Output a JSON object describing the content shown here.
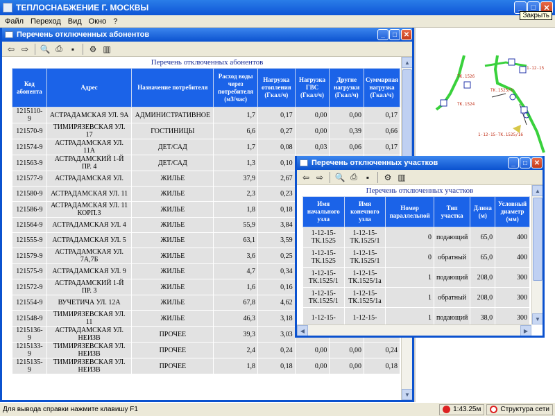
{
  "app": {
    "title": "ТЕПЛОСНАБЖЕНИЕ Г. МОСКВЫ",
    "close_tooltip": "Закрыть"
  },
  "menu": [
    "Файл",
    "Переход",
    "Вид",
    "Окно",
    "?"
  ],
  "status": {
    "message": "Для вывода справки нажмите клавишу F1",
    "time": "1:43.25м",
    "network": "Структура сети"
  },
  "win1": {
    "title": "Перечень отключенных абонентов",
    "caption": "Перечень отключенных абонентов",
    "columns": [
      "Код абонента",
      "Адрес",
      "Назначение потребителя",
      "Расход воды через потребителя (м3/час)",
      "Нагрузка отопления (Гкал/ч)",
      "Нагрузка ГВС (Гкал/ч)",
      "Другие нагрузки (Гкал/ч)",
      "Суммарная нагрузка (Гкал/ч)"
    ],
    "rows": [
      [
        "1215110-9",
        "АСТРАДАМСКАЯ УЛ. 9А",
        "АДМИНИСТРАТИВНОЕ",
        "1,7",
        "0,17",
        "0,00",
        "0,00",
        "0,17"
      ],
      [
        "121570-9",
        "ТИМИРЯЗЕВСКАЯ УЛ. 17",
        "ГОСТИНИЦЫ",
        "6,6",
        "0,27",
        "0,00",
        "0,39",
        "0,66"
      ],
      [
        "121574-9",
        "АСТРАДАМСКАЯ УЛ. 11А",
        "ДЕТ/САД",
        "1,7",
        "0,08",
        "0,03",
        "0,06",
        "0,17"
      ],
      [
        "121563-9",
        "АСТРАДАМСКИЙ 1-Й ПР. 4",
        "ДЕТ/САД",
        "1,3",
        "0,10",
        "",
        "",
        ""
      ],
      [
        "121577-9",
        "АСТРАДАМСКАЯ УЛ.",
        "ЖИЛЬЕ",
        "37,9",
        "2,67",
        "",
        "",
        ""
      ],
      [
        "121580-9",
        "АСТРАДАМСКАЯ УЛ. 11",
        "ЖИЛЬЕ",
        "2,3",
        "0,23",
        "",
        "",
        ""
      ],
      [
        "121586-9",
        "АСТРАДАМСКАЯ УЛ. 11 КОРП.3",
        "ЖИЛЬЕ",
        "1,8",
        "0,18",
        "",
        "",
        ""
      ],
      [
        "121564-9",
        "АСТРАДАМСКАЯ УЛ. 4",
        "ЖИЛЬЕ",
        "55,9",
        "3,84",
        "",
        "",
        ""
      ],
      [
        "121555-9",
        "АСТРАДАМСКАЯ УЛ. 5",
        "ЖИЛЬЕ",
        "63,1",
        "3,59",
        "",
        "",
        ""
      ],
      [
        "121579-9",
        "АСТРАДАМСКАЯ УЛ. 7А,7Б",
        "ЖИЛЬЕ",
        "3,6",
        "0,25",
        "",
        "",
        ""
      ],
      [
        "121575-9",
        "АСТРАДАМСКАЯ УЛ. 9",
        "ЖИЛЬЕ",
        "4,7",
        "0,34",
        "",
        "",
        ""
      ],
      [
        "121572-9",
        "АСТРАДАМСКИЙ 1-Й ПР. 3",
        "ЖИЛЬЕ",
        "1,6",
        "0,16",
        "",
        "",
        ""
      ],
      [
        "121554-9",
        "ВУЧЕТИЧА УЛ. 12А",
        "ЖИЛЬЕ",
        "67,8",
        "4,62",
        "",
        "",
        ""
      ],
      [
        "121548-9",
        "ТИМИРЯЗЕВСКАЯ УЛ. 11",
        "ЖИЛЬЕ",
        "46,3",
        "3,18",
        "",
        "",
        ""
      ],
      [
        "1215136-9",
        "АСТРАДАМСКАЯ УЛ. НЕИЗВ",
        "ПРОЧЕЕ",
        "39,3",
        "3,03",
        "",
        "",
        ""
      ],
      [
        "1215133-9",
        "ТИМИРЯЗЕВСКАЯ УЛ. НЕИЗВ",
        "ПРОЧЕЕ",
        "2,4",
        "0,24",
        "0,00",
        "0,00",
        "0,24"
      ],
      [
        "1215135-9",
        "ТИМИРЯЗЕВСКАЯ УЛ. НЕИЗВ",
        "ПРОЧЕЕ",
        "1,8",
        "0,18",
        "0,00",
        "0,00",
        "0,18"
      ]
    ]
  },
  "win2": {
    "title": "Перечень отключенных участков",
    "caption": "Перечень отключенных участков",
    "columns": [
      "Имя начального узла",
      "Имя конечного узла",
      "Номер параллельной",
      "Тип участка",
      "Длина (м)",
      "Условный диаметр (мм)"
    ],
    "rows": [
      [
        "1-12-15-ТК.1525",
        "1-12-15-ТК.1525/1",
        "0",
        "подающий",
        "65,0",
        "400"
      ],
      [
        "1-12-15-ТК.1525",
        "1-12-15-ТК.1525/1",
        "0",
        "обратный",
        "65,0",
        "400"
      ],
      [
        "1-12-15-ТК.1525/1",
        "1-12-15-ТК.1525/1а",
        "1",
        "подающий",
        "208,0",
        "300"
      ],
      [
        "1-12-15-ТК.1525/1",
        "1-12-15-ТК.1525/1а",
        "1",
        "обратный",
        "208,0",
        "300"
      ],
      [
        "1-12-15-",
        "1-12-15-",
        "1",
        "подающий",
        "38,0",
        "300"
      ]
    ]
  },
  "map_labels": [
    "ТК.1526",
    "1-12-15",
    "ТК.1525/1",
    "1-12-15-ТК.1525/16",
    "ТК.1524"
  ]
}
